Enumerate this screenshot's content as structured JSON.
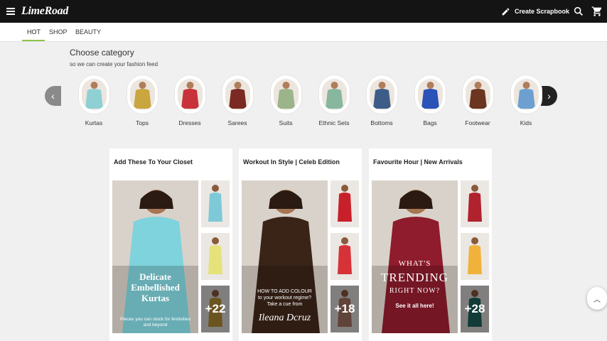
{
  "header": {
    "logo": "LimeRoad",
    "create_scrapbook": "Create Scrapbook"
  },
  "tabs": [
    {
      "label": "HOT",
      "active": true
    },
    {
      "label": "SHOP",
      "active": false
    },
    {
      "label": "BEAUTY",
      "active": false
    }
  ],
  "categories_section": {
    "title": "Choose category",
    "subtitle": "so we can create your fashion feed",
    "prev_icon": "chevron-left-icon",
    "next_icon": "chevron-right-icon",
    "items": [
      {
        "label": "Kurtas",
        "color": "#8ed0d4"
      },
      {
        "label": "Tops",
        "color": "#c9a640"
      },
      {
        "label": "Dresses",
        "color": "#c8323a"
      },
      {
        "label": "Sarees",
        "color": "#7a2a22"
      },
      {
        "label": "Suits",
        "color": "#9bb48a"
      },
      {
        "label": "Ethnic Sets",
        "color": "#88b7a0"
      },
      {
        "label": "Bottoms",
        "color": "#3d5d88"
      },
      {
        "label": "Bags",
        "color": "#2a52b8"
      },
      {
        "label": "Footwear",
        "color": "#6b3520"
      },
      {
        "label": "Kids",
        "color": "#6da0d0"
      }
    ]
  },
  "feed": [
    {
      "title": "Add These To Your Closet",
      "hero_color": "#7fd3dc",
      "hero_lines": [
        "Delicate",
        "Embellished",
        "Kurtas"
      ],
      "hero_note": "Pieces you can stock for festivities and beyond",
      "more": "+22",
      "thumb_colors": [
        "#7ec9d8",
        "#e6e27a",
        "#c49a3a"
      ]
    },
    {
      "title": "Workout In Style | Celeb Edition",
      "hero_color": "#3a2418",
      "hero_lines": [
        "HOW TO ADD COLOUR",
        "to your workout regime?",
        "Take a cue from"
      ],
      "hero_note": "Ileana Dcruz",
      "more": "+18",
      "thumb_colors": [
        "#c8202a",
        "#d63238",
        "#b07a68"
      ]
    },
    {
      "title": "Favourite Hour | New Arrivals",
      "hero_color": "#8e1c2c",
      "hero_lines": [
        "WHAT'S",
        "TRENDING",
        "RIGHT NOW?"
      ],
      "hero_note": "See it all here!",
      "more": "+28",
      "thumb_colors": [
        "#b0232e",
        "#f0b23a",
        "#1f6c64"
      ]
    }
  ],
  "scroll_top_icon": "chevron-up-icon"
}
